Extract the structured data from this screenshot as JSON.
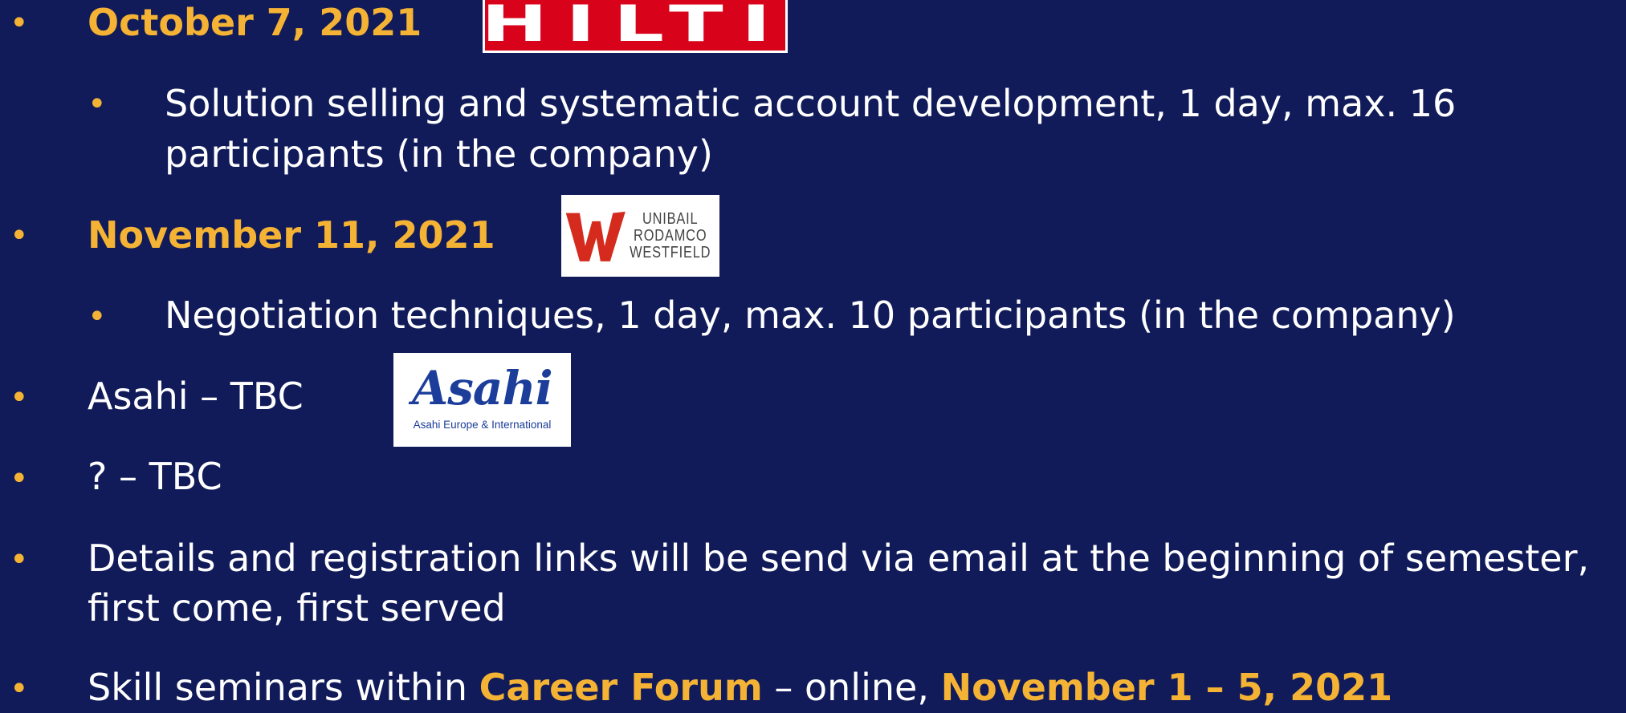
{
  "items": [
    {
      "date": "October 7, 2021"
    },
    {
      "detail": "Solution selling and systematic account development, 1 day, max. 16",
      "detail_cont": "participants (in the company)"
    },
    {
      "date": "November 11, 2021"
    },
    {
      "detail": "Negotiation techniques, 1 day, max. 10 participants (in the company)"
    },
    {
      "text": "Asahi – TBC"
    },
    {
      "text": "? – TBC"
    },
    {
      "text": "Details and registration links will be send via email at the beginning of semester,",
      "text_cont": "first come, first served"
    },
    {
      "prefix": "Skill seminars within ",
      "highlight1": "Career Forum",
      "middle": " – online, ",
      "highlight2": "November 1 – 5, 2021"
    }
  ],
  "logos": {
    "hilti": {
      "text": "HILTI",
      "color": "#d9021b"
    },
    "urw": {
      "line1": "UNIBAIL",
      "line2": "RODAMCO",
      "line3": "WESTFIELD",
      "color": "#d52b1e"
    },
    "asahi": {
      "brand": "Asahi",
      "sub": "Asahi Europe & International",
      "color": "#1c3e9a"
    }
  },
  "colors": {
    "background": "#111b59",
    "accent": "#f5b335",
    "text": "#ffffff"
  }
}
